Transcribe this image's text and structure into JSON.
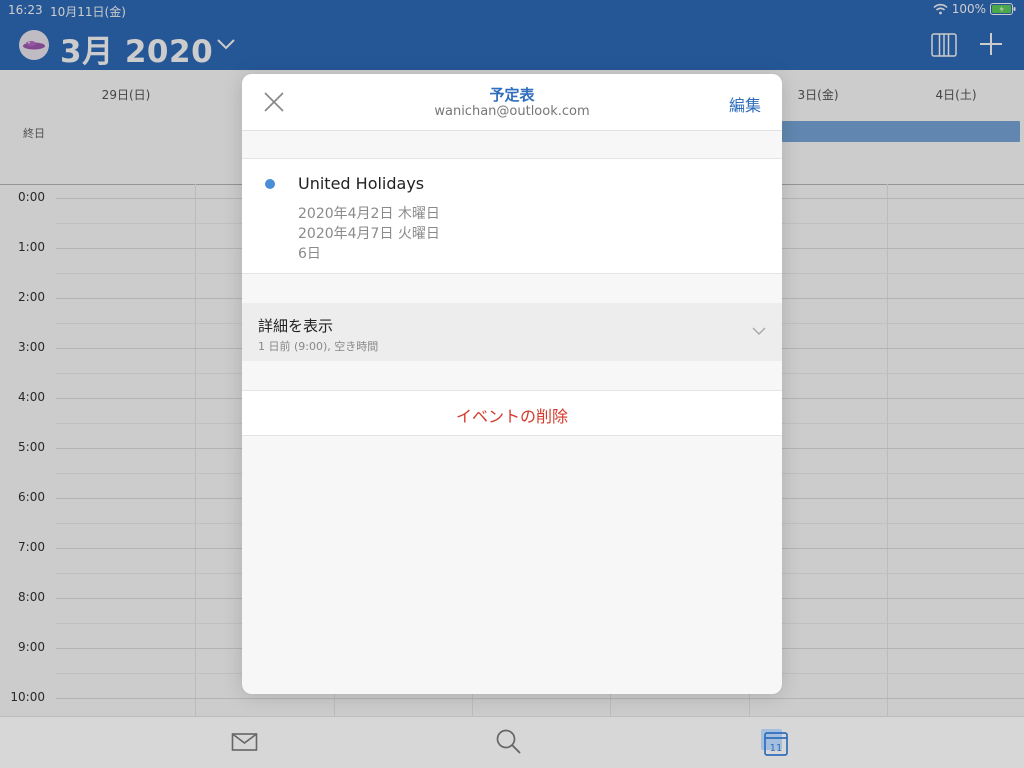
{
  "status_bar": {
    "time": "16:23",
    "date": "10月11日(金)",
    "battery": "100%"
  },
  "header": {
    "month_title": "3月 2020",
    "icons": [
      "avatar",
      "chevron-down-icon",
      "week-view-icon",
      "plus-icon"
    ],
    "background_color": "#2f6dbd"
  },
  "calendar": {
    "day_headers": [
      "29日(日)",
      "3日(金)",
      "4日(土)"
    ],
    "allday_label": "終日",
    "hours": [
      "0:00",
      "1:00",
      "2:00",
      "3:00",
      "4:00",
      "5:00",
      "6:00",
      "7:00",
      "8:00",
      "9:00",
      "10:00"
    ],
    "event_color": "#7aa9dd"
  },
  "modal": {
    "title": "予定表",
    "subtitle": "wanichan@outlook.com",
    "edit_label": "編集",
    "event": {
      "title": "United Holidays",
      "start": "2020年4月2日 木曜日",
      "end": "2020年4月7日 火曜日",
      "duration": "6日",
      "color": "#4a8ed8"
    },
    "details": {
      "label": "詳細を表示",
      "sub": "1 日前 (9:00), 空き時間"
    },
    "delete_label": "イベントの削除",
    "delete_color": "#d33a2c"
  },
  "tab_bar": {
    "tabs": [
      "mail-icon",
      "search-icon",
      "calendar-icon"
    ],
    "calendar_badge": "11"
  }
}
